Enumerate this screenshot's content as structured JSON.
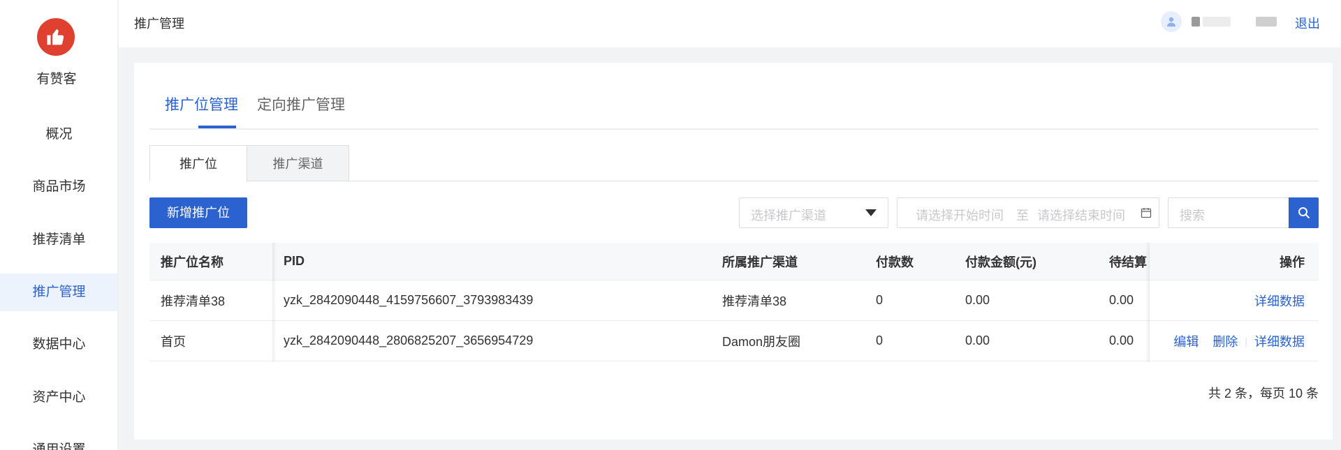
{
  "sidebar": {
    "brand": "有赞客",
    "items": [
      {
        "label": "概况"
      },
      {
        "label": "商品市场"
      },
      {
        "label": "推荐清单"
      },
      {
        "label": "推广管理"
      },
      {
        "label": "数据中心"
      },
      {
        "label": "资产中心"
      },
      {
        "label": "通用设置"
      }
    ],
    "active_index": 3,
    "logo_color": "#e0402f",
    "logo_icon": "thumbs-up-icon"
  },
  "topbar": {
    "title": "推广管理",
    "logout": "退出",
    "avatar_icon": "user-icon"
  },
  "tabs": [
    {
      "label": "推广位管理"
    },
    {
      "label": "定向推广管理"
    }
  ],
  "subtabs": [
    {
      "label": "推广位"
    },
    {
      "label": "推广渠道"
    }
  ],
  "toolbar": {
    "add_label": "新增推广位",
    "channel_placeholder": "选择推广渠道",
    "date_start_placeholder": "请选择开始时间",
    "date_sep": "至",
    "date_end_placeholder": "请选择结束时间",
    "search_placeholder": "搜索"
  },
  "table": {
    "headers": {
      "name": "推广位名称",
      "pid": "PID",
      "channel": "所属推广渠道",
      "pay_count": "付款数",
      "pay_amount": "付款金额(元)",
      "pending": "待结算",
      "op": "操作"
    },
    "rows": [
      {
        "name": "推荐清单38",
        "pid": "yzk_2842090448_4159756607_3793983439",
        "channel": "推荐清单38",
        "pay_count": "0",
        "pay_amount": "0.00",
        "pending": "0.00",
        "ops": [
          "详细数据"
        ]
      },
      {
        "name": "首页",
        "pid": "yzk_2842090448_2806825207_3656954729",
        "channel": "Damon朋友圈",
        "pay_count": "0",
        "pay_amount": "0.00",
        "pending": "0.00",
        "ops": [
          "编辑",
          "删除",
          "详细数据"
        ]
      }
    ]
  },
  "pagination": {
    "summary": "共 2 条，每页 10 条"
  },
  "colors": {
    "accent": "#2b62d0",
    "logo": "#e0402f"
  }
}
